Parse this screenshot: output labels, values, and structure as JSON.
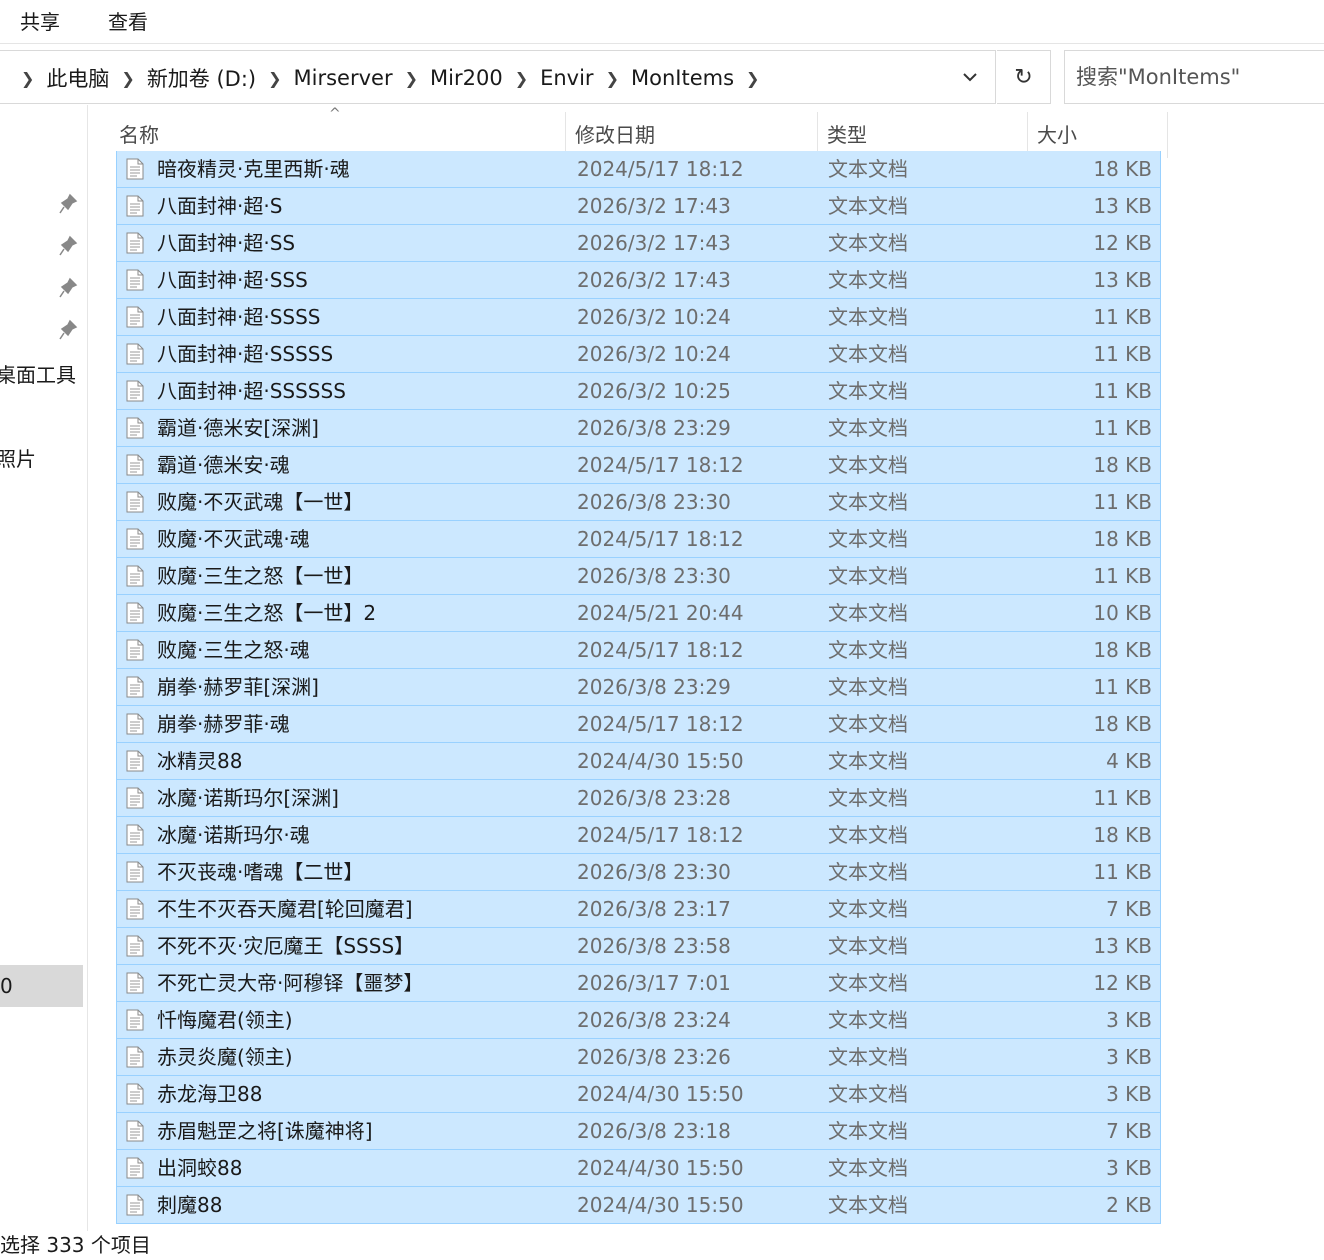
{
  "ribbon": {
    "tabs": [
      "共享",
      "查看"
    ]
  },
  "address": {
    "crumbs": [
      "此电脑",
      "新加卷 (D:)",
      "Mirserver",
      "Mir200",
      "Envir",
      "MonItems"
    ]
  },
  "search": {
    "placeholder": "搜索\"MonItems\""
  },
  "nav": {
    "labels": [
      "桌面工具",
      "照片"
    ],
    "selected_label": "0"
  },
  "columns": {
    "name": "名称",
    "date": "修改日期",
    "type": "类型",
    "size": "大小"
  },
  "files": [
    {
      "name": "暗夜精灵·克里西斯·魂",
      "date": "2024/5/17 18:12",
      "type": "文本文档",
      "size": "18 KB"
    },
    {
      "name": "八面封神·超·S",
      "date": "2026/3/2 17:43",
      "type": "文本文档",
      "size": "13 KB"
    },
    {
      "name": "八面封神·超·SS",
      "date": "2026/3/2 17:43",
      "type": "文本文档",
      "size": "12 KB"
    },
    {
      "name": "八面封神·超·SSS",
      "date": "2026/3/2 17:43",
      "type": "文本文档",
      "size": "13 KB"
    },
    {
      "name": "八面封神·超·SSSS",
      "date": "2026/3/2 10:24",
      "type": "文本文档",
      "size": "11 KB"
    },
    {
      "name": "八面封神·超·SSSSS",
      "date": "2026/3/2 10:24",
      "type": "文本文档",
      "size": "11 KB"
    },
    {
      "name": "八面封神·超·SSSSSS",
      "date": "2026/3/2 10:25",
      "type": "文本文档",
      "size": "11 KB"
    },
    {
      "name": "霸道·德米安[深渊]",
      "date": "2026/3/8 23:29",
      "type": "文本文档",
      "size": "11 KB"
    },
    {
      "name": "霸道·德米安·魂",
      "date": "2024/5/17 18:12",
      "type": "文本文档",
      "size": "18 KB"
    },
    {
      "name": "败魔·不灭武魂【一世】",
      "date": "2026/3/8 23:30",
      "type": "文本文档",
      "size": "11 KB"
    },
    {
      "name": "败魔·不灭武魂·魂",
      "date": "2024/5/17 18:12",
      "type": "文本文档",
      "size": "18 KB"
    },
    {
      "name": "败魔·三生之怒【一世】",
      "date": "2026/3/8 23:30",
      "type": "文本文档",
      "size": "11 KB"
    },
    {
      "name": "败魔·三生之怒【一世】2",
      "date": "2024/5/21 20:44",
      "type": "文本文档",
      "size": "10 KB"
    },
    {
      "name": "败魔·三生之怒·魂",
      "date": "2024/5/17 18:12",
      "type": "文本文档",
      "size": "18 KB"
    },
    {
      "name": "崩拳·赫罗菲[深渊]",
      "date": "2026/3/8 23:29",
      "type": "文本文档",
      "size": "11 KB"
    },
    {
      "name": "崩拳·赫罗菲·魂",
      "date": "2024/5/17 18:12",
      "type": "文本文档",
      "size": "18 KB"
    },
    {
      "name": "冰精灵88",
      "date": "2024/4/30 15:50",
      "type": "文本文档",
      "size": "4 KB"
    },
    {
      "name": "冰魔·诺斯玛尔[深渊]",
      "date": "2026/3/8 23:28",
      "type": "文本文档",
      "size": "11 KB"
    },
    {
      "name": "冰魔·诺斯玛尔·魂",
      "date": "2024/5/17 18:12",
      "type": "文本文档",
      "size": "18 KB"
    },
    {
      "name": "不灭丧魂·嗜魂【二世】",
      "date": "2026/3/8 23:30",
      "type": "文本文档",
      "size": "11 KB"
    },
    {
      "name": "不生不灭吞天魔君[轮回魔君]",
      "date": "2026/3/8 23:17",
      "type": "文本文档",
      "size": "7 KB"
    },
    {
      "name": "不死不灭·灾厄魔王【SSSS】",
      "date": "2026/3/8 23:58",
      "type": "文本文档",
      "size": "13 KB"
    },
    {
      "name": "不死亡灵大帝·阿穆铎【噩梦】",
      "date": "2026/3/17 7:01",
      "type": "文本文档",
      "size": "12 KB"
    },
    {
      "name": "忏悔魔君(领主)",
      "date": "2026/3/8 23:24",
      "type": "文本文档",
      "size": "3 KB"
    },
    {
      "name": "赤灵炎魔(领主)",
      "date": "2026/3/8 23:26",
      "type": "文本文档",
      "size": "3 KB"
    },
    {
      "name": "赤龙海卫88",
      "date": "2024/4/30 15:50",
      "type": "文本文档",
      "size": "3 KB"
    },
    {
      "name": "赤眉魁罡之将[诛魔神将]",
      "date": "2026/3/8 23:18",
      "type": "文本文档",
      "size": "7 KB"
    },
    {
      "name": "出洞蛟88",
      "date": "2024/4/30 15:50",
      "type": "文本文档",
      "size": "3 KB"
    },
    {
      "name": "刺魔88",
      "date": "2024/4/30 15:50",
      "type": "文本文档",
      "size": "2 KB"
    }
  ],
  "status": "选择 333 个项目",
  "colors": {
    "selection_bg": "#cce8ff",
    "selection_border": "#99d1ff"
  }
}
